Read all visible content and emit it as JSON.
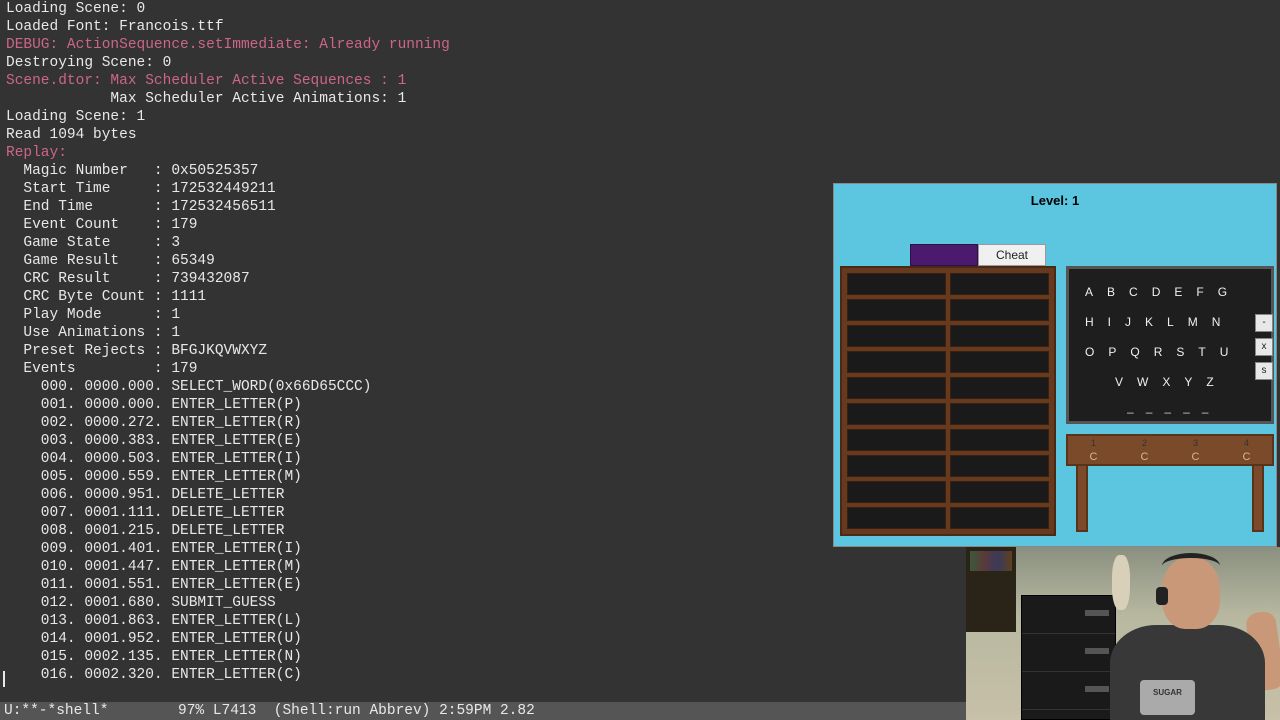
{
  "terminal": {
    "lines": [
      {
        "text": "Loading Scene: 0",
        "cls": ""
      },
      {
        "text": "Loaded Font: Francois.ttf",
        "cls": ""
      },
      {
        "text": "DEBUG: ActionSequence.setImmediate: Already running",
        "cls": "pink"
      },
      {
        "text": "Destroying Scene: 0",
        "cls": ""
      },
      {
        "text": "Scene.dtor: Max Scheduler Active Sequences : 1",
        "cls": "pink"
      },
      {
        "text": "            Max Scheduler Active Animations: 1",
        "cls": ""
      },
      {
        "text": "Loading Scene: 1",
        "cls": ""
      },
      {
        "text": "Read 1094 bytes",
        "cls": ""
      },
      {
        "text": "Replay:",
        "cls": "pink"
      },
      {
        "text": "  Magic Number   : 0x50525357",
        "cls": ""
      },
      {
        "text": "  Start Time     : 172532449211",
        "cls": ""
      },
      {
        "text": "  End Time       : 172532456511",
        "cls": ""
      },
      {
        "text": "  Event Count    : 179",
        "cls": ""
      },
      {
        "text": "  Game State     : 3",
        "cls": ""
      },
      {
        "text": "  Game Result    : 65349",
        "cls": ""
      },
      {
        "text": "  CRC Result     : 739432087",
        "cls": ""
      },
      {
        "text": "  CRC Byte Count : 1111",
        "cls": ""
      },
      {
        "text": "  Play Mode      : 1",
        "cls": ""
      },
      {
        "text": "  Use Animations : 1",
        "cls": ""
      },
      {
        "text": "  Preset Rejects : BFGJKQVWXYZ",
        "cls": ""
      },
      {
        "text": "  Events         : 179",
        "cls": ""
      },
      {
        "text": "    000. 0000.000. SELECT_WORD(0x66D65CCC)",
        "cls": ""
      },
      {
        "text": "    001. 0000.000. ENTER_LETTER(P)",
        "cls": ""
      },
      {
        "text": "    002. 0000.272. ENTER_LETTER(R)",
        "cls": ""
      },
      {
        "text": "    003. 0000.383. ENTER_LETTER(E)",
        "cls": ""
      },
      {
        "text": "    004. 0000.503. ENTER_LETTER(I)",
        "cls": ""
      },
      {
        "text": "    005. 0000.559. ENTER_LETTER(M)",
        "cls": ""
      },
      {
        "text": "    006. 0000.951. DELETE_LETTER",
        "cls": ""
      },
      {
        "text": "    007. 0001.111. DELETE_LETTER",
        "cls": ""
      },
      {
        "text": "    008. 0001.215. DELETE_LETTER",
        "cls": ""
      },
      {
        "text": "    009. 0001.401. ENTER_LETTER(I)",
        "cls": ""
      },
      {
        "text": "    010. 0001.447. ENTER_LETTER(M)",
        "cls": ""
      },
      {
        "text": "    011. 0001.551. ENTER_LETTER(E)",
        "cls": ""
      },
      {
        "text": "    012. 0001.680. SUBMIT_GUESS",
        "cls": ""
      },
      {
        "text": "    013. 0001.863. ENTER_LETTER(L)",
        "cls": ""
      },
      {
        "text": "    014. 0001.952. ENTER_LETTER(U)",
        "cls": ""
      },
      {
        "text": "    015. 0002.135. ENTER_LETTER(N)",
        "cls": ""
      },
      {
        "text": "    016. 0002.320. ENTER_LETTER(C)",
        "cls": ""
      }
    ]
  },
  "status": "U:**-*shell*        97% L7413  (Shell:run Abbrev) 2:59PM 2.82",
  "game": {
    "level_label": "Level: 1",
    "cheat_label": "Cheat",
    "alphabet_rows": [
      [
        "A",
        "B",
        "C",
        "D",
        "E",
        "F",
        "G"
      ],
      [
        "H",
        "I",
        "J",
        "K",
        "L",
        "M",
        "N"
      ],
      [
        "O",
        "P",
        "Q",
        "R",
        "S",
        "T",
        "U"
      ],
      [
        "V",
        "W",
        "X",
        "Y",
        "Z"
      ]
    ],
    "dashes": [
      "–",
      "–",
      "–",
      "–",
      "–"
    ],
    "side_buttons": [
      "-",
      "x",
      "s"
    ],
    "table_nums": [
      "1",
      "2",
      "3",
      "4"
    ],
    "table_marks": [
      "C",
      "C",
      "C",
      "C"
    ]
  },
  "webcam": {
    "shirt_text": "SUGAR"
  }
}
